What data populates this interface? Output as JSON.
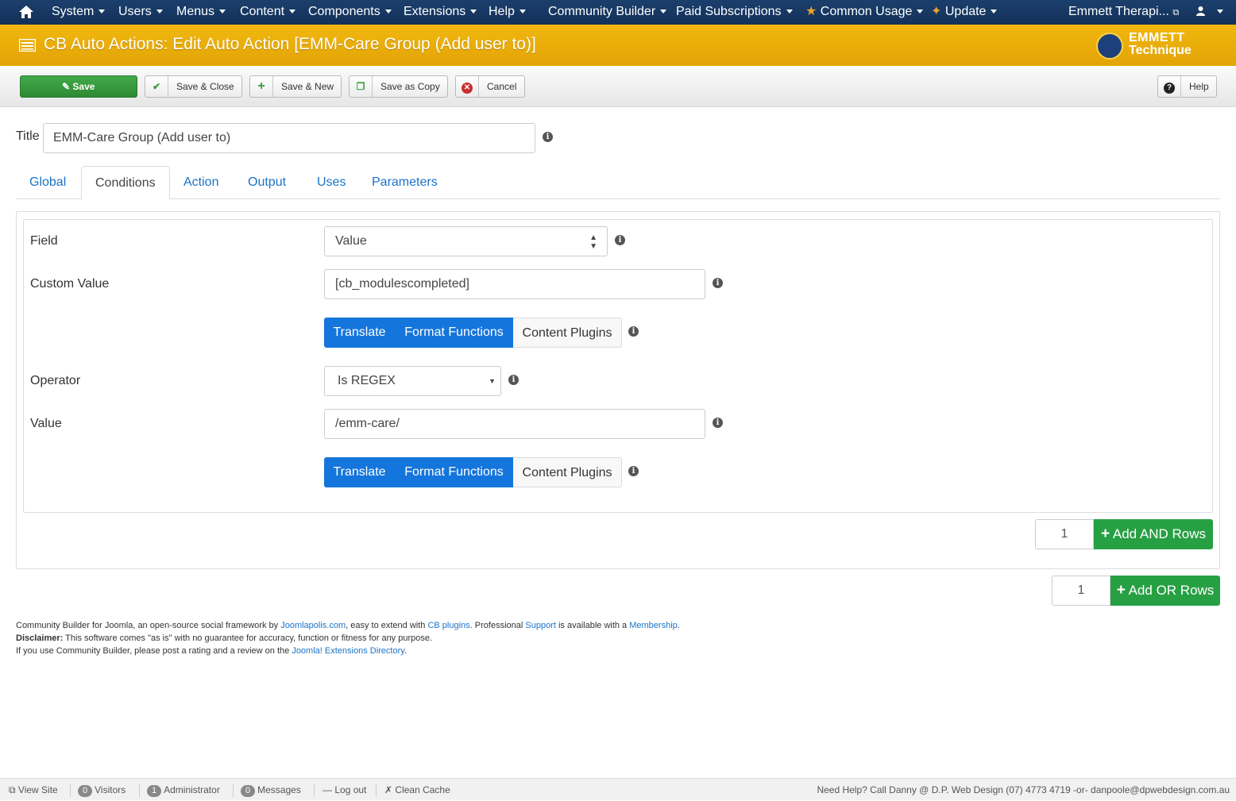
{
  "nav": {
    "menus": [
      "System",
      "Users",
      "Menus",
      "Content",
      "Components",
      "Extensions",
      "Help",
      "Community Builder",
      "Paid Subscriptions",
      "Common Usage",
      "Update"
    ],
    "site_name": "Emmett Therapi..."
  },
  "header": {
    "title": "CB Auto Actions: Edit Auto Action [EMM-Care Group (Add user to)]",
    "logo_line1": "EMMETT",
    "logo_line2": "Technique"
  },
  "toolbar": {
    "save": "Save",
    "save_close": "Save & Close",
    "save_new": "Save & New",
    "save_copy": "Save as Copy",
    "cancel": "Cancel",
    "help": "Help"
  },
  "form": {
    "title_label": "Title",
    "title_value": "EMM-Care Group (Add user to)"
  },
  "tabs": [
    "Global",
    "Conditions",
    "Action",
    "Output",
    "Uses",
    "Parameters"
  ],
  "conditions": {
    "field_label": "Field",
    "field_value": "Value",
    "custom_value_label": "Custom Value",
    "custom_value": "[cb_modulescompleted]",
    "btn_translate": "Translate",
    "btn_format": "Format Functions",
    "btn_plugins": "Content Plugins",
    "operator_label": "Operator",
    "operator_value": "Is REGEX",
    "value_label": "Value",
    "value": "/emm-care/",
    "and_count": "1",
    "add_and": "Add AND Rows",
    "or_count": "1",
    "add_or": "Add OR Rows"
  },
  "footer": {
    "line1_a": "Community Builder for Joomla, an open-source social framework by ",
    "link_joomlapolis": "Joomlapolis.com",
    "line1_b": ", easy to extend with ",
    "link_plugins": "CB plugins",
    "line1_c": ". Professional ",
    "link_support": "Support",
    "line1_d": " is available with a ",
    "link_membership": "Membership",
    "line1_e": ".",
    "disclaimer_label": "Disclaimer:",
    "disclaimer_text": " This software comes \"as is\" with no guarantee for accuracy, function or fitness for any purpose.",
    "line3_a": "If you use Community Builder, please post a rating and a review on the ",
    "link_jed": "Joomla! Extensions Directory",
    "line3_b": "."
  },
  "status": {
    "view_site": "View Site",
    "visitors_count": "0",
    "visitors": "Visitors",
    "admin_count": "1",
    "admin": "Administrator",
    "messages_count": "0",
    "messages": "Messages",
    "logout": "Log out",
    "clean_cache": "Clean Cache",
    "help_text": "Need Help? Call Danny @ D.P. Web Design (07) 4773 4719 -or- danpoole@dpwebdesign.com.au"
  },
  "colors": {
    "nav_bg": "#17375e",
    "header_bg": "#e9ad0a",
    "primary_blue": "#1475dc",
    "success_green": "#27a044"
  }
}
